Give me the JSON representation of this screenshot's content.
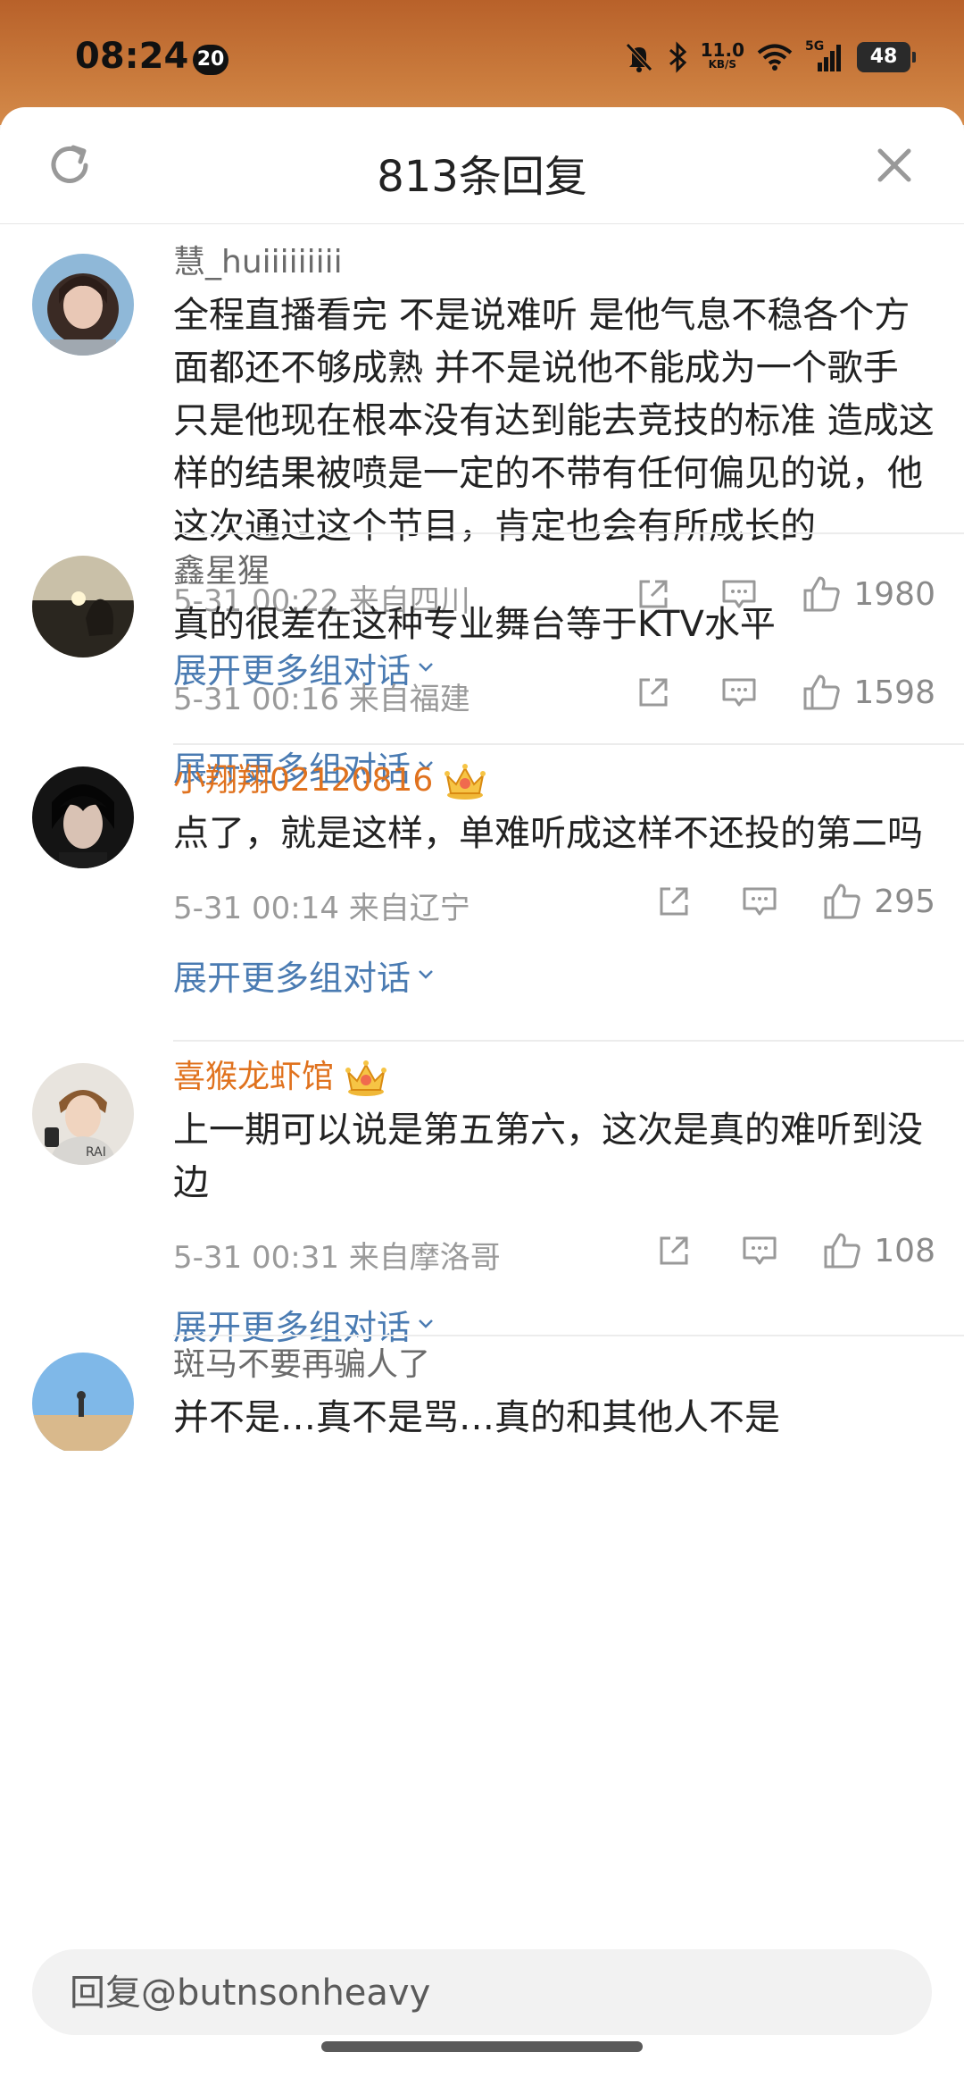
{
  "status_bar": {
    "time": "08:24",
    "badge": "20",
    "net_speed_top": "11.0",
    "net_speed_unit": "KB/S",
    "network": "5G",
    "battery": "48"
  },
  "header": {
    "title": "813条回复"
  },
  "comments": [
    {
      "username": "慧_huiiiiiiiii",
      "vip": false,
      "text": "全程直播看完 不是说难听 是他气息不稳各个方面都还不够成熟 并不是说他不能成为一个歌手 只是他现在根本没有达到能去竞技的标准 造成这样的结果被喷是一定的不带有任何偏见的说，他这次通过这个节目，肯定也会有所成长的",
      "time": "5-31 00:22",
      "location": "来自四川",
      "likes": "1980",
      "expand": "展开更多组对话"
    },
    {
      "username": "鑫星猩",
      "vip": false,
      "text": "真的很差在这种专业舞台等于KTV水平",
      "time": "5-31 00:16",
      "location": "来自福建",
      "likes": "1598",
      "expand": "展开更多组对话"
    },
    {
      "username": "小翔翔02120816",
      "vip": true,
      "text": "点了，就是这样，单难听成这样不还投的第二吗",
      "time": "5-31 00:14",
      "location": "来自辽宁",
      "likes": "295",
      "expand": "展开更多组对话"
    },
    {
      "username": "喜猴龙虾馆",
      "vip": true,
      "text": "上一期可以说是第五第六，这次是真的难听到没边",
      "time": "5-31 00:31",
      "location": "来自摩洛哥",
      "likes": "108",
      "expand": "展开更多组对话"
    },
    {
      "username": "斑马不要再骗人了",
      "vip": false,
      "text": "并不是…真不是骂…真的和其他人不是"
    }
  ],
  "reply": {
    "placeholder": "回复@butnsonheavy"
  },
  "colors": {
    "vip_name": "#e0721e",
    "link": "#4a7bb2",
    "status_bar": "#c2703a"
  }
}
